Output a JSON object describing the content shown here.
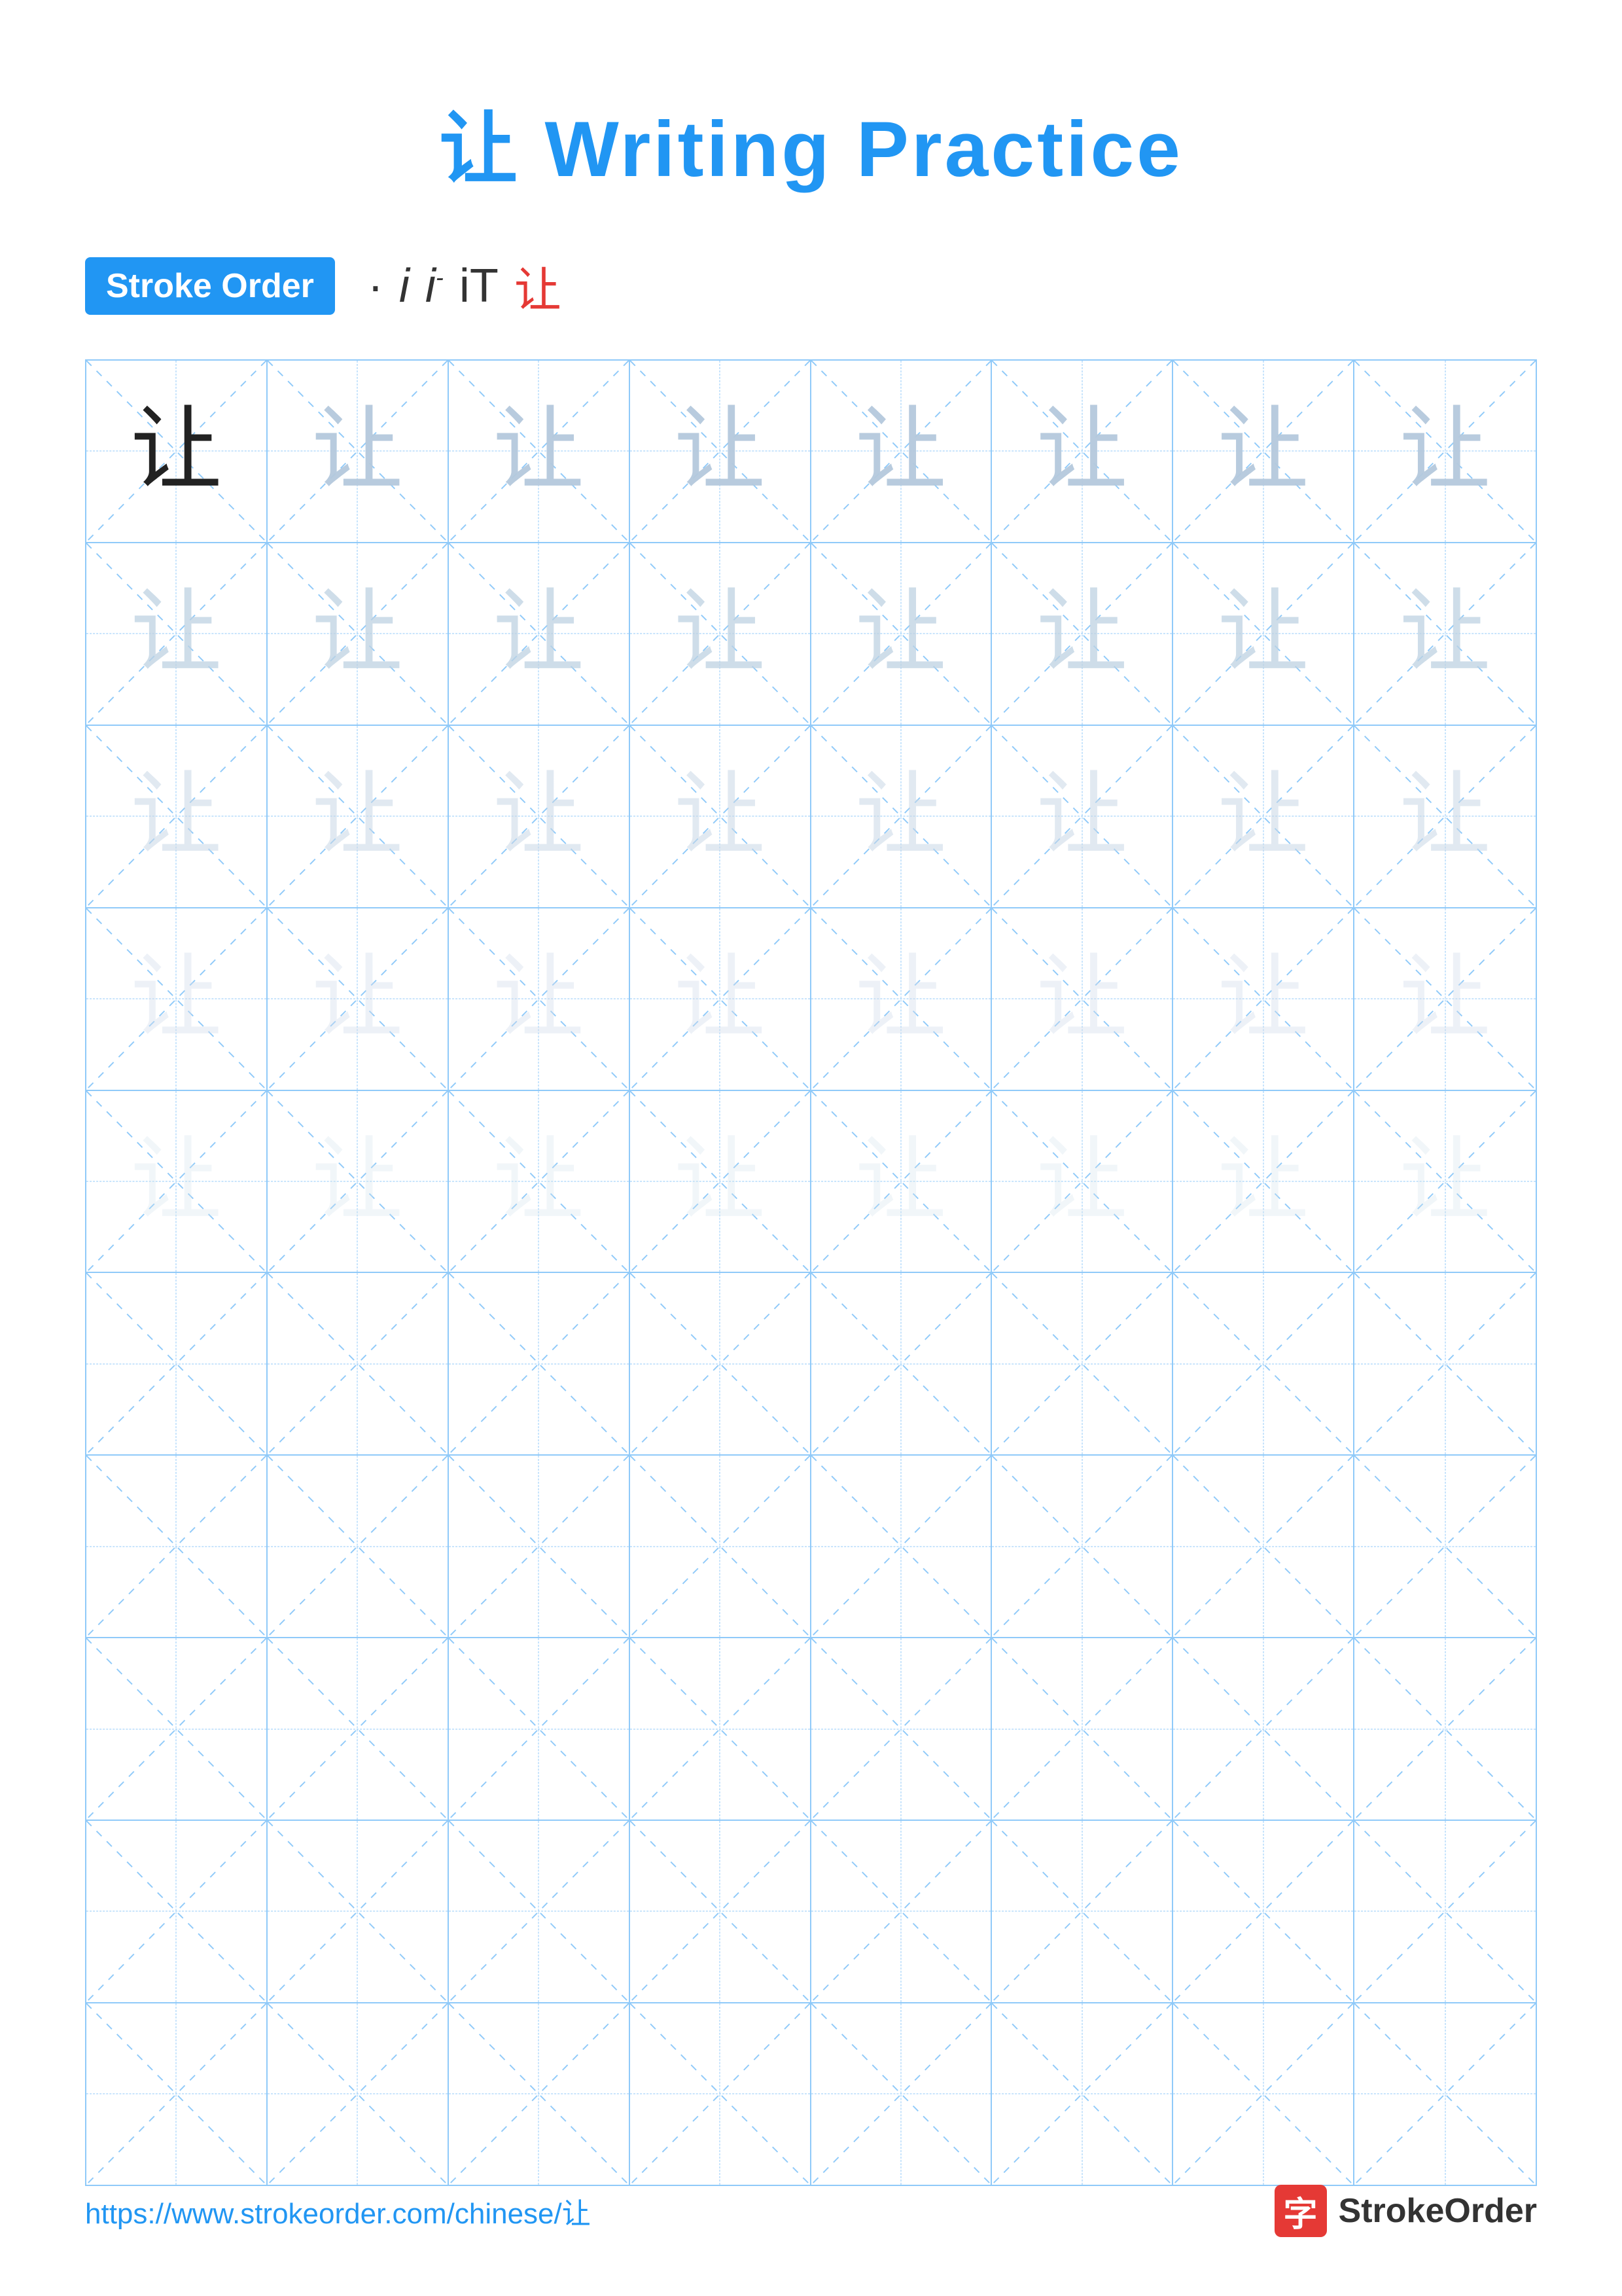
{
  "title": "让 Writing Practice",
  "stroke_order": {
    "badge_label": "Stroke Order",
    "strokes": [
      "·",
      "i",
      "i-",
      "iT",
      "让"
    ]
  },
  "grid": {
    "rows": 10,
    "cols": 8,
    "character": "让",
    "filled_rows": 5
  },
  "footer": {
    "url": "https://www.strokeorder.com/chinese/让",
    "brand_char": "字",
    "brand_name": "StrokeOrder"
  }
}
